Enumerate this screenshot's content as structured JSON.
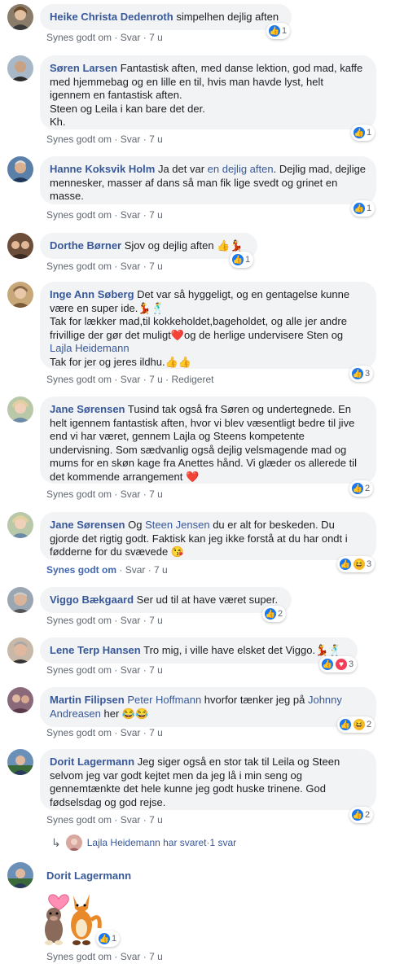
{
  "actions": {
    "like": "Synes godt om",
    "reply": "Svar",
    "sep": " · ",
    "time": "7 u",
    "edited": "Redigeret"
  },
  "comments": [
    {
      "name": "Heike Christa Dedenroth",
      "text": " simpelhen dejlig aften",
      "reactions": "1"
    },
    {
      "name": "Søren Larsen",
      "text": " Fantastisk aften, med danse lektion, god mad, kaffe med hjemmebag og en lille en til, hvis man havde lyst, helt igennem en fantastisk aften.",
      "text2": "Steen og Leila i kan bare det der.",
      "text3": "Kh.",
      "reactions": "1"
    },
    {
      "name": "Hanne Koksvik Holm",
      "text_a": " Ja det var ",
      "link": "en dejlig aften",
      "text_b": ". Dejlig mad, dejlige mennesker, masser af dans så man fik lige svedt og grinet en masse.",
      "reactions": "1"
    },
    {
      "name": "Dorthe Børner",
      "text": " Sjov og dejlig aften ",
      "emoji": "👍💃",
      "reactions": "1"
    },
    {
      "name": "Inge Ann Søberg",
      "text": " Det var så hyggeligt, og en gentagelse kunne være en super ide.",
      "emoji": "💃🕺",
      "text2": "Tak for lækker mad,til kokkeholdet,bageholdet, og alle jer andre frivillige der gør det muligt",
      "emoji2": "❤️",
      "text3": "og de herlige undervisere Sten og",
      "link": "Lajla Heidemann",
      "text4": "Tak for jer og jeres ildhu.",
      "emoji3": "👍👍",
      "reactions": "3"
    },
    {
      "name": "Jane Sørensen",
      "text": " Tusind tak også fra Søren og undertegnede. En helt igennem fantastisk aften, hvor vi blev væsentligt bedre til jive end vi har været, gennem Lajla og Steens kompetente undervisning. Som sædvanlig også dejlig velsmagende mad og mums for en skøn kage fra Anettes hånd. Vi glæder os allerede til det kommende arrangement ",
      "emoji": "❤️",
      "reactions": "2"
    },
    {
      "name": "Jane Sørensen",
      "text_a": " Og ",
      "link": "Steen Jensen",
      "text_b": " du er alt for beskeden. Du gjorde det rigtig godt. Faktisk kan jeg ikke forstå at du har ondt i fødderne for du svævede ",
      "emoji": "😘",
      "reactions": "3"
    },
    {
      "name": "Viggo Bækgaard",
      "text": " Ser ud til at have været super.",
      "reactions": "2"
    },
    {
      "name": "Lene Terp Hansen",
      "text": " Tro mig, i ville have elsket det Viggo.",
      "emoji": "💃🕺",
      "reactions": "3"
    },
    {
      "name": "Martin Filipsen",
      "link1": "Peter Hoffmann",
      "text_a": " hvorfor tænker jeg på ",
      "link2": "Johnny Andreasen",
      "text_b": " her ",
      "emoji": "😂😂",
      "reactions": "2"
    },
    {
      "name": "Dorit Lagermann",
      "text": " Jeg siger også en stor tak til Leila og Steen selvom jeg var godt kejtet men da jeg lå i min seng og gennemtænkte det hele kunne jeg godt huske trinene. God fødselsdag og god rejse.",
      "reactions": "2"
    },
    {
      "name": "Dorit Lagermann",
      "reactions": "1"
    }
  ],
  "reply_thread": {
    "arrow": "↳",
    "text": "Lajla Heidemann har svaret",
    "sep": " · ",
    "count": "1 svar"
  },
  "colors": {
    "name": "#385898",
    "bubble": "#f2f3f5",
    "meta": "#606770",
    "like": "#1877f2"
  }
}
